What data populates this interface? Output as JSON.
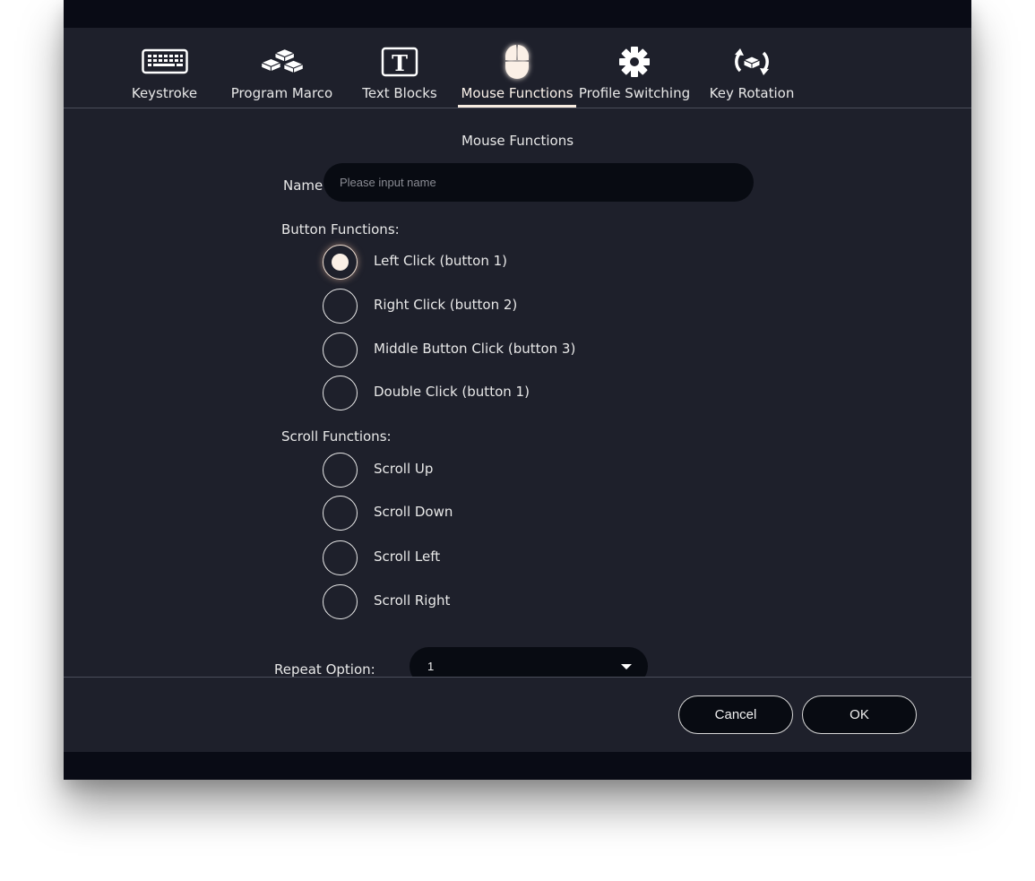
{
  "tabs": [
    {
      "label": "Keystroke",
      "icon": "keyboard-icon",
      "active": false
    },
    {
      "label": "Program Marco",
      "icon": "keycaps-icon",
      "active": false
    },
    {
      "label": "Text Blocks",
      "icon": "text-block-icon",
      "active": false
    },
    {
      "label": "Mouse Functions",
      "icon": "mouse-icon",
      "active": true
    },
    {
      "label": "Profile Switching",
      "icon": "gear-icon",
      "active": false
    },
    {
      "label": "Key Rotation",
      "icon": "key-rotation-icon",
      "active": false
    }
  ],
  "panel": {
    "title": "Mouse Functions",
    "name_label": "Name",
    "name_placeholder": "Please input name",
    "name_value": ""
  },
  "button_functions": {
    "label": "Button Functions:",
    "options": [
      {
        "label": "Left Click (button 1)",
        "checked": true
      },
      {
        "label": "Right Click (button 2)",
        "checked": false
      },
      {
        "label": "Middle Button Click (button 3)",
        "checked": false
      },
      {
        "label": "Double Click (button 1)",
        "checked": false
      }
    ]
  },
  "scroll_functions": {
    "label": "Scroll Functions:",
    "options": [
      {
        "label": "Scroll Up",
        "checked": false
      },
      {
        "label": "Scroll Down",
        "checked": false
      },
      {
        "label": "Scroll Left",
        "checked": false
      },
      {
        "label": "Scroll Right",
        "checked": false
      }
    ]
  },
  "repeat": {
    "label": "Repeat Option:",
    "value": "1"
  },
  "footer": {
    "cancel_label": "Cancel",
    "ok_label": "OK"
  },
  "colors": {
    "background": "#1e202b",
    "bar": "#090b15",
    "input": "#080b12",
    "accent": "#f7ebe0"
  }
}
